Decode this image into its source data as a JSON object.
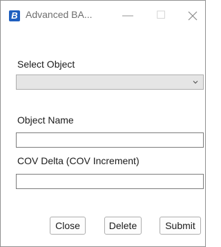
{
  "window": {
    "title": "Advanced BA...",
    "app_icon_letter": "B",
    "minimize_glyph": "—",
    "maximize_glyph": "☐"
  },
  "form": {
    "select_object_label": "Select Object",
    "select_object_value": "",
    "object_name_label": "Object Name",
    "object_name_value": "",
    "cov_delta_label": "COV Delta (COV Increment)",
    "cov_delta_value": ""
  },
  "buttons": {
    "close_label": "Close",
    "delete_label": "Delete",
    "submit_label": "Submit"
  },
  "colors": {
    "app_icon": "#1f5fbf",
    "select_background": "#e5e5e5"
  },
  "icons": {
    "app": "app-logo-icon",
    "minimize": "minimize-icon",
    "maximize": "maximize-icon",
    "close": "close-icon",
    "dropdown": "chevron-down-icon"
  }
}
